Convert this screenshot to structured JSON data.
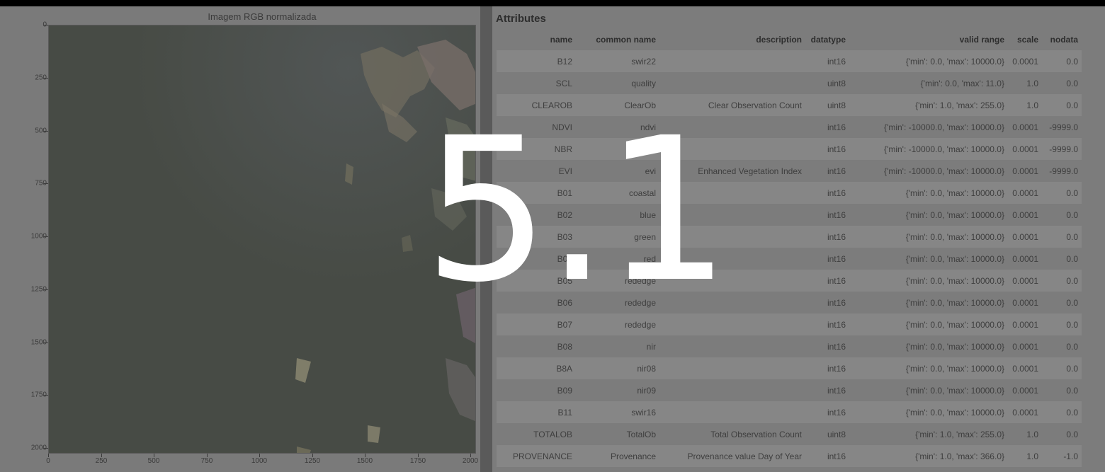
{
  "plot": {
    "title": "Imagem RGB normalizada",
    "yticks": [
      "0",
      "250",
      "500",
      "750",
      "1000",
      "1250",
      "1500",
      "1750",
      "2000"
    ],
    "xticks": [
      "0",
      "250",
      "500",
      "750",
      "1000",
      "1250",
      "1500",
      "1750",
      "2000"
    ],
    "image_colors": {
      "forest": "#4a4f49",
      "cleared": "#8a7e78",
      "haze": "#5a5f63"
    }
  },
  "attributes": {
    "heading": "Attributes",
    "columns": [
      "name",
      "common name",
      "description",
      "datatype",
      "valid range",
      "scale",
      "nodata"
    ],
    "rows": [
      [
        "B12",
        "swir22",
        "",
        "int16",
        "{'min': 0.0, 'max': 10000.0}",
        "0.0001",
        "0.0"
      ],
      [
        "SCL",
        "quality",
        "",
        "uint8",
        "{'min': 0.0, 'max': 11.0}",
        "1.0",
        "0.0"
      ],
      [
        "CLEAROB",
        "ClearOb",
        "Clear Observation Count",
        "uint8",
        "{'min': 1.0, 'max': 255.0}",
        "1.0",
        "0.0"
      ],
      [
        "NDVI",
        "ndvi",
        "",
        "int16",
        "{'min': -10000.0, 'max': 10000.0}",
        "0.0001",
        "-9999.0"
      ],
      [
        "NBR",
        "nbr",
        "",
        "int16",
        "{'min': -10000.0, 'max': 10000.0}",
        "0.0001",
        "-9999.0"
      ],
      [
        "EVI",
        "evi",
        "Enhanced Vegetation Index",
        "int16",
        "{'min': -10000.0, 'max': 10000.0}",
        "0.0001",
        "-9999.0"
      ],
      [
        "B01",
        "coastal",
        "",
        "int16",
        "{'min': 0.0, 'max': 10000.0}",
        "0.0001",
        "0.0"
      ],
      [
        "B02",
        "blue",
        "",
        "int16",
        "{'min': 0.0, 'max': 10000.0}",
        "0.0001",
        "0.0"
      ],
      [
        "B03",
        "green",
        "",
        "int16",
        "{'min': 0.0, 'max': 10000.0}",
        "0.0001",
        "0.0"
      ],
      [
        "B04",
        "red",
        "",
        "int16",
        "{'min': 0.0, 'max': 10000.0}",
        "0.0001",
        "0.0"
      ],
      [
        "B05",
        "rededge",
        "",
        "int16",
        "{'min': 0.0, 'max': 10000.0}",
        "0.0001",
        "0.0"
      ],
      [
        "B06",
        "rededge",
        "",
        "int16",
        "{'min': 0.0, 'max': 10000.0}",
        "0.0001",
        "0.0"
      ],
      [
        "B07",
        "rededge",
        "",
        "int16",
        "{'min': 0.0, 'max': 10000.0}",
        "0.0001",
        "0.0"
      ],
      [
        "B08",
        "nir",
        "",
        "int16",
        "{'min': 0.0, 'max': 10000.0}",
        "0.0001",
        "0.0"
      ],
      [
        "B8A",
        "nir08",
        "",
        "int16",
        "{'min': 0.0, 'max': 10000.0}",
        "0.0001",
        "0.0"
      ],
      [
        "B09",
        "nir09",
        "",
        "int16",
        "{'min': 0.0, 'max': 10000.0}",
        "0.0001",
        "0.0"
      ],
      [
        "B11",
        "swir16",
        "",
        "int16",
        "{'min': 0.0, 'max': 10000.0}",
        "0.0001",
        "0.0"
      ],
      [
        "TOTALOB",
        "TotalOb",
        "Total Observation Count",
        "uint8",
        "{'min': 1.0, 'max': 255.0}",
        "1.0",
        "0.0"
      ],
      [
        "PROVENANCE",
        "Provenance",
        "Provenance value Day of Year",
        "int16",
        "{'min': 1.0, 'max': 366.0}",
        "1.0",
        "-1.0"
      ]
    ]
  },
  "overlay": {
    "number": "5.1"
  }
}
